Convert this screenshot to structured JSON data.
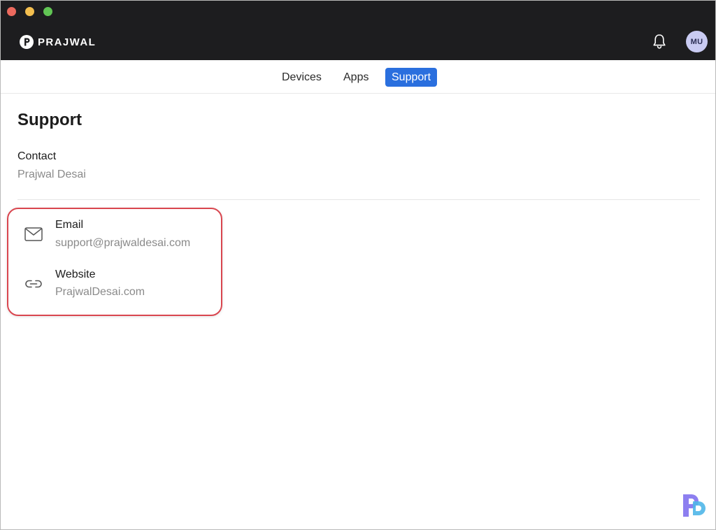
{
  "brand": {
    "name": "PRAJWAL"
  },
  "header": {
    "avatar_initials": "MU"
  },
  "nav": {
    "tabs": [
      {
        "label": "Devices",
        "active": false
      },
      {
        "label": "Apps",
        "active": false
      },
      {
        "label": "Support",
        "active": true
      }
    ]
  },
  "main": {
    "title": "Support",
    "contact": {
      "label": "Contact",
      "value": "Prajwal Desai"
    },
    "items": [
      {
        "icon": "mail-icon",
        "title": "Email",
        "value": "support@prajwaldesai.com"
      },
      {
        "icon": "link-icon",
        "title": "Website",
        "value": "PrajwalDesai.com"
      }
    ]
  },
  "colors": {
    "titlebar": "#1d1d1f",
    "accent": "#2a6fde",
    "highlight": "#d9464f",
    "avatar_bg": "#c9cbf2"
  }
}
